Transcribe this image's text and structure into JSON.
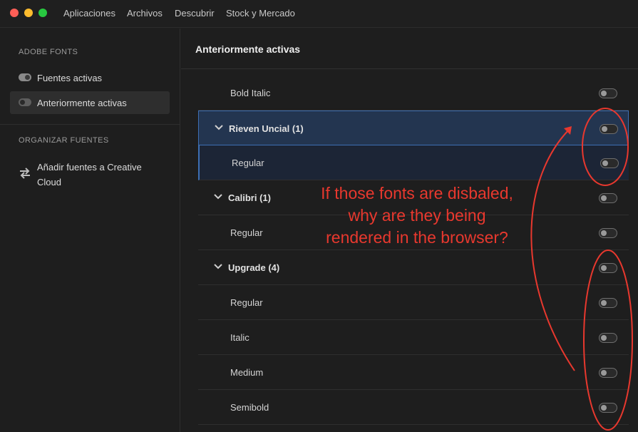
{
  "titlebar": {
    "menu": [
      "Aplicaciones",
      "Archivos",
      "Descubrir",
      "Stock y Mercado"
    ]
  },
  "sidebar": {
    "adobe_fonts_label": "ADOBE FONTS",
    "items": [
      {
        "label": "Fuentes activas",
        "toggle_on": true
      },
      {
        "label": "Anteriormente activas",
        "toggle_on": false,
        "selected": true
      }
    ],
    "organize_label": "ORGANIZAR FUENTES",
    "add_fonts_label": "Añadir fuentes a Creative Cloud",
    "add_fonts_icon": "sync-arrows-icon"
  },
  "main": {
    "title": "Anteriormente activas",
    "rows": [
      {
        "kind": "style",
        "label": "Bold Italic",
        "active": false
      },
      {
        "kind": "family",
        "label": "Rieven Uncial (1)",
        "active": false,
        "selected": true
      },
      {
        "kind": "style",
        "label": "Regular",
        "active": false,
        "selected_child": true
      },
      {
        "kind": "family",
        "label": "Calibri (1)",
        "active": false
      },
      {
        "kind": "style",
        "label": "Regular",
        "active": false
      },
      {
        "kind": "family",
        "label": "Upgrade (4)",
        "active": false
      },
      {
        "kind": "style",
        "label": "Regular",
        "active": false
      },
      {
        "kind": "style",
        "label": "Italic",
        "active": false
      },
      {
        "kind": "style",
        "label": "Medium",
        "active": false
      },
      {
        "kind": "style",
        "label": "Semibold",
        "active": false
      }
    ]
  },
  "annotation": {
    "lines": [
      "If those fonts are disbaled,",
      "why are they being",
      "rendered in the browser?"
    ],
    "color": "#e8382e"
  },
  "colors": {
    "selection_border": "#3d6fb4",
    "selection_bg": "#233550"
  }
}
